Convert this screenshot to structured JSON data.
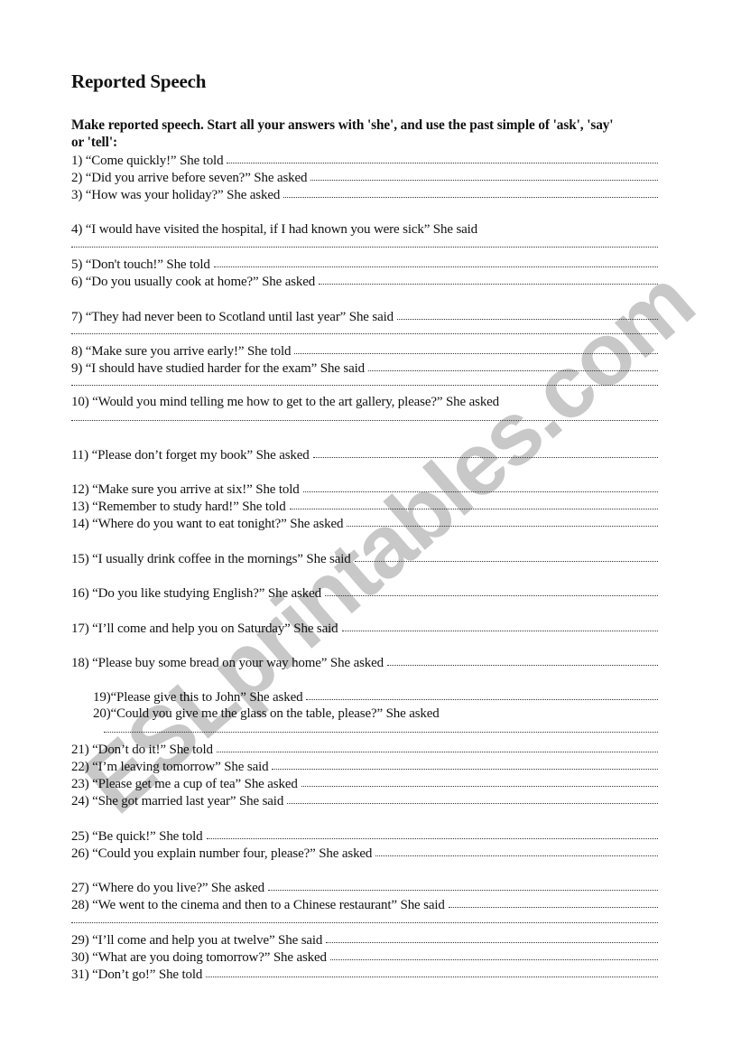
{
  "document": {
    "title": "Reported Speech",
    "instructions": {
      "line1": "Make reported speech. Start all your answers with 'she', and use the past simple of 'ask', 'say'",
      "line2": "or 'tell':"
    },
    "watermark": {
      "text": "ESLprintables.com",
      "color": "#c8c8c8"
    },
    "items": [
      {
        "text": "1) “Come quickly!” She told"
      },
      {
        "text": "2) “Did you arrive before seven?”  She asked"
      },
      {
        "text": "3) “How was your holiday?” She asked"
      },
      {
        "text": "4) “I would have visited the hospital, if I had known you were sick”    She  said"
      },
      {
        "text": "5) “Don't touch!” She told"
      },
      {
        "text": "6) “Do you usually cook at home?” She asked"
      },
      {
        "text": "7) “They had never been to Scotland until last year” She said"
      },
      {
        "text": "8) “Make sure you arrive early!” She told"
      },
      {
        "text": "9) “I should have studied harder for the exam” She said"
      },
      {
        "text": "10) “Would you mind telling me how to get to the art gallery, please?” She asked"
      },
      {
        "text": "11) “Please don’t forget my book” She asked"
      },
      {
        "text": "12) “Make sure you arrive at six!” She told"
      },
      {
        "text": "13) “Remember to study hard!” She told"
      },
      {
        "text": "14) “Where do you want to eat tonight?” She asked"
      },
      {
        "text": "15) “I usually drink coffee in the mornings” She said"
      },
      {
        "text": "16) “Do you like studying English?” She asked"
      },
      {
        "text": "17) “I’ll come and help you on Saturday”  She said"
      },
      {
        "text": "18) “Please buy some bread on your way home” She asked"
      },
      {
        "text": "19)“Please give this to John” She asked"
      },
      {
        "text": "20)“Could you give me the glass on the table, please?” She asked"
      },
      {
        "text": "21) “Don’t do it!” She told"
      },
      {
        "text": "22) “I’m leaving tomorrow” She said"
      },
      {
        "text": "23) “Please get me a cup of tea” She asked"
      },
      {
        "text": "24) “She got married last year” She said"
      },
      {
        "text": "25) “Be quick!”  She told"
      },
      {
        "text": "26) “Could you explain number four, please?” She asked"
      },
      {
        "text": "27) “Where do you live?” She asked"
      },
      {
        "text": "28) “We went to the cinema and then to a Chinese restaurant” She said"
      },
      {
        "text": "29) “I’ll come and help you at twelve” She said"
      },
      {
        "text": "30) “What are you doing tomorrow?” She asked"
      },
      {
        "text": "31) “Don’t go!”  She told"
      }
    ]
  }
}
